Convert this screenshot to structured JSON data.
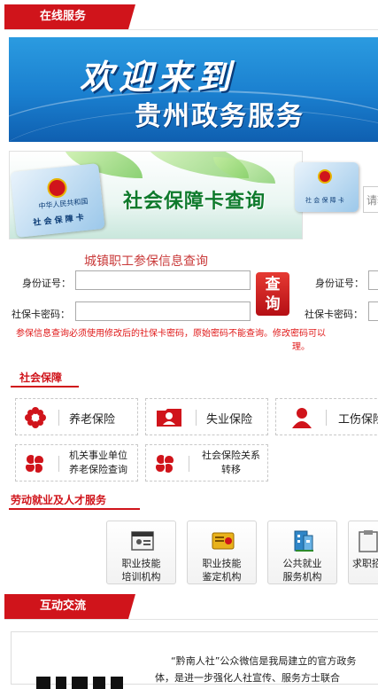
{
  "online_service": {
    "tab_label": "在线服务"
  },
  "welcome_banner": {
    "line1": "欢迎来到",
    "line2": "贵州政务服务"
  },
  "card_banner": {
    "title": "社会保障卡查询",
    "card_text_top": "中华人民共和国",
    "card_text_bottom": "社 会 保 障 卡"
  },
  "side_search": {
    "placeholder": "请输"
  },
  "query_form": {
    "title": "城镇职工参保信息查询",
    "id_label": "身份证号：",
    "pwd_label": "社保卡密码：",
    "query_button": "查询",
    "right_id_label": "身份证号：",
    "right_pwd_label": "社保卡密码：",
    "note_line1": "参保信息查询必须使用修改后的社保卡密码，原始密码不能查询。修改密码可以",
    "note_line2": "理。"
  },
  "social_security": {
    "heading": "社会保障",
    "items": [
      {
        "label": "养老保险",
        "icon": "flower-icon"
      },
      {
        "label": "失业保险",
        "icon": "id-card-icon"
      },
      {
        "label": "工伤保险",
        "icon": "person-icon"
      },
      {
        "label_line1": "机关事业单位",
        "label_line2": "养老保险查询",
        "icon": "clover-icon"
      },
      {
        "label_line1": "社会保险关系",
        "label_line2": "转移",
        "icon": "clover-icon"
      }
    ]
  },
  "employment": {
    "heading": "劳动就业及人才服务",
    "tiles": [
      {
        "line1": "职业技能",
        "line2": "培训机构",
        "icon": "certificate-icon"
      },
      {
        "line1": "职业技能",
        "line2": "鉴定机构",
        "icon": "badge-icon"
      },
      {
        "line1": "公共就业",
        "line2": "服务机构",
        "icon": "building-icon"
      },
      {
        "line1": "求职招",
        "line2": "",
        "icon": "clipboard-icon"
      }
    ]
  },
  "interaction": {
    "tab_label": "互动交流",
    "wechat_line1": "“黔南人社”公众微信是我局建立的官方政务",
    "wechat_line2": "体，是进一步强化人社宣传、服务方士联合"
  },
  "colors": {
    "brand_red": "#d0141b",
    "banner_blue": "#1a7fcf",
    "title_green": "#0e7a2c"
  }
}
